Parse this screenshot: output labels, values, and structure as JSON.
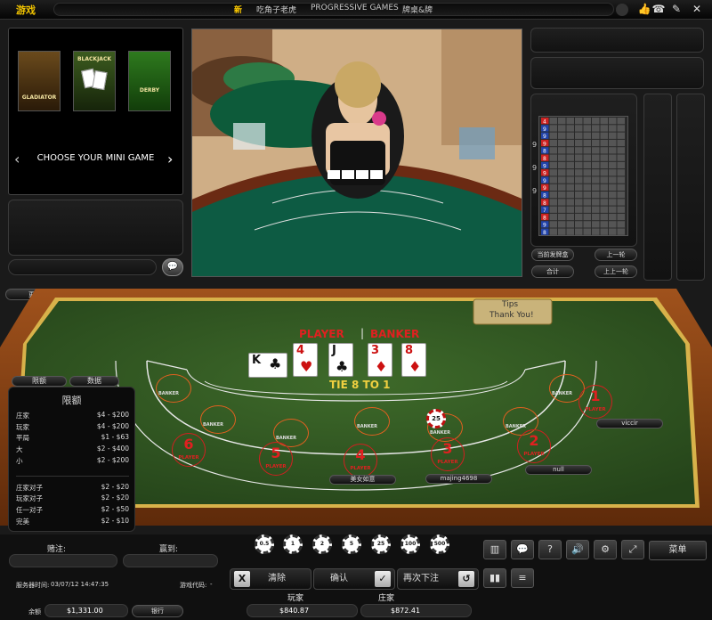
{
  "topbar": {
    "title": "游戏",
    "nav": [
      "新",
      "吃角子老虎",
      "PROGRESSIVE GAMES",
      "牌桌&牌"
    ],
    "icons": [
      "thumbs-up-icon",
      "phone-icon",
      "settings-icon",
      "close-icon"
    ]
  },
  "mini_game": {
    "games": [
      "GLADIATOR",
      "BLACKJACK",
      "DERBY"
    ],
    "label": "CHOOSE YOUR MINI GAME"
  },
  "history": {
    "labels": [
      "4",
      "9",
      "9",
      "9",
      "8",
      "8",
      "9",
      "9",
      "9",
      "9",
      "8",
      "8",
      "7",
      "8",
      "9",
      "8"
    ],
    "label_colors": [
      "#cc2222",
      "#2244aa",
      "#2244aa",
      "#cc2222",
      "#2244aa",
      "#cc2222",
      "#2244aa",
      "#cc2222",
      "#2244aa",
      "#cc2222",
      "#2244aa",
      "#cc2222",
      "#2244aa",
      "#cc2222",
      "#2244aa",
      "#2244aa"
    ],
    "side_marks": [
      "9",
      "9",
      "9"
    ]
  },
  "side_buttons": {
    "current_shoe": "当前发牌盒",
    "total": "合计",
    "prev_round": "上一轮",
    "prev_prev_round": "上上一轮"
  },
  "seat_button": "更换座位",
  "tips_sign": {
    "line1": "Tips",
    "line2": "Thank You!"
  },
  "table": {
    "player_label": "PLAYER",
    "banker_label": "BANKER",
    "tie_label": "TIE 8 TO 1",
    "cards": [
      {
        "rank": "K",
        "suit": "♣",
        "color": "#111111"
      },
      {
        "rank": "4",
        "suit": "♥",
        "color": "#cc1111"
      },
      {
        "rank": "J",
        "suit": "♣",
        "color": "#111111"
      },
      {
        "rank": "3",
        "suit": "♦",
        "color": "#cc1111"
      },
      {
        "rank": "8",
        "suit": "♦",
        "color": "#cc1111"
      }
    ],
    "banker_spot": "BANKER",
    "player_spot": "PLAYER",
    "seats": [
      "1",
      "2",
      "3",
      "4",
      "5",
      "6"
    ],
    "bet_chip": "25",
    "names": {
      "seat1": "viccir",
      "seat2": "null",
      "seat3": "majing4698",
      "seat4": "美女如意"
    }
  },
  "limit_tabs": {
    "limits": "限额",
    "data": "数据"
  },
  "limits": {
    "header": "限额",
    "rows": [
      {
        "label": "庄家",
        "value": "$4 - $200"
      },
      {
        "label": "玩家",
        "value": "$4 - $200"
      },
      {
        "label": "平局",
        "value": "$1 - $63"
      },
      {
        "label": "大",
        "value": "$2 - $400"
      },
      {
        "label": "小",
        "value": "$2 - $200"
      },
      {
        "label": "庄家对子",
        "value": "$2 - $20"
      },
      {
        "label": "玩家对子",
        "value": "$2 - $20"
      },
      {
        "label": "任一对子",
        "value": "$2 - $50"
      },
      {
        "label": "完美",
        "value": "$2 - $10"
      }
    ]
  },
  "bottom": {
    "bet_label": "赌注:",
    "win_label": "赢到:",
    "server_time_label": "服务器时间:",
    "server_time": "03/07/12 14:47:35",
    "game_code_label": "游戏代码:",
    "game_code": "-",
    "balance_label": "余额",
    "balance": "$1,331.00",
    "cashier": "银行",
    "chips": [
      "0.5",
      "1",
      "2",
      "5",
      "25",
      "100",
      "500"
    ],
    "clear": "清除",
    "confirm": "确认",
    "rebet": "再次下注",
    "player_total_label": "玩家",
    "player_total": "$840.87",
    "banker_total_label": "庄家",
    "banker_total": "$872.41",
    "menu": "菜单"
  }
}
